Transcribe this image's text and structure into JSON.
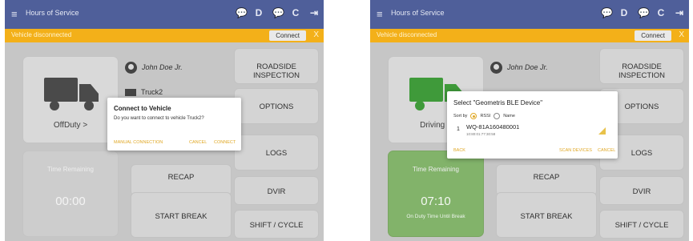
{
  "left": {
    "appbar": {
      "title": "Hours of Service",
      "menu_icon": "≡",
      "icons": [
        "💬",
        "D",
        "💬",
        "C",
        "⇥"
      ]
    },
    "warning": {
      "text": "Vehicle disconnected",
      "connect_label": "Connect",
      "close_label": "X"
    },
    "status": {
      "label": "OffDuty  >"
    },
    "driver": {
      "name": "John Doe Jr."
    },
    "vehicle": {
      "name": "Truck2"
    },
    "time": {
      "label": "Time Remaining",
      "value": "00:00"
    },
    "buttons": {
      "recap": "RECAP",
      "start_break": "START BREAK",
      "roadside": "ROADSIDE INSPECTION",
      "options": "OPTIONS",
      "logs": "LOGS",
      "dvir": "DVIR",
      "shift": "SHIFT / CYCLE"
    },
    "dialog": {
      "title": "Connect to Vehicle",
      "message": "Do you want to connect to vehicle Truck2?",
      "manual": "MANUAL CONNECTION",
      "cancel": "CANCEL",
      "connect": "CONNECT"
    }
  },
  "right": {
    "appbar": {
      "title": "Hours of Service",
      "menu_icon": "≡",
      "icons": [
        "💬",
        "D",
        "💬",
        "C",
        "⇥"
      ]
    },
    "warning": {
      "text": "Vehicle disconnected",
      "connect_label": "Connect",
      "close_label": "X"
    },
    "status": {
      "label": "Driving  >"
    },
    "driver": {
      "name": "John Doe Jr."
    },
    "time": {
      "label": "Time Remaining",
      "value": "07:10",
      "sub": "On Duty Time Until Break"
    },
    "buttons": {
      "recap": "RECAP",
      "start_break": "START BREAK",
      "roadside": "ROADSIDE INSPECTION",
      "options": "OPTIONS",
      "logs": "LOGS",
      "dvir": "DVIR",
      "shift": "SHIFT / CYCLE"
    },
    "dialog": {
      "title": "Select \"Geometris BLE Device\"",
      "sort_label": "Sort by",
      "sort_rssi": "RSSI",
      "sort_name": "Name",
      "device_index": "1",
      "device_name": "WQ-81A160480001",
      "device_address": "10:80:01:77:30:58",
      "back": "BACK",
      "scan": "SCAN DEVICES",
      "cancel": "CANCEL"
    }
  },
  "colors": {
    "appbar": "#4f5f9a",
    "warning": "#f3b019",
    "accent": "#e0a826",
    "driving_green": "#82b36a",
    "truck_dark": "#4a4a4a",
    "truck_green": "#3f9a3a"
  }
}
